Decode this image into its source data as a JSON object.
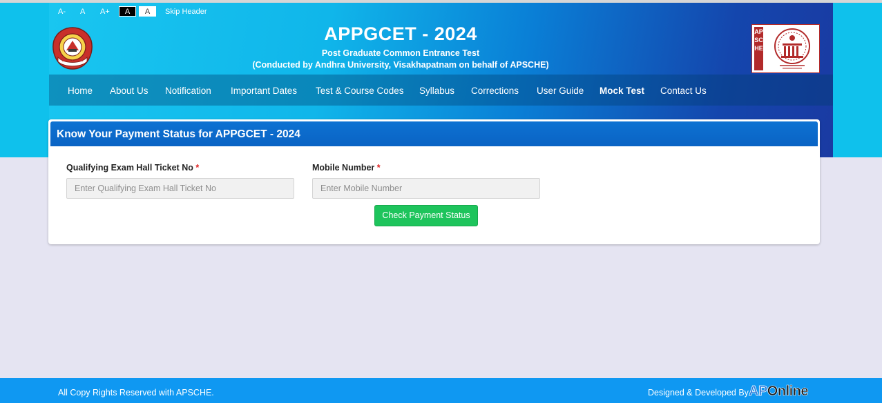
{
  "accessibility": {
    "decrease": "A-",
    "normal": "A",
    "increase": "A+",
    "dark_contrast": "A",
    "light_contrast": "A",
    "skip_header": "Skip Header"
  },
  "header": {
    "title": "APPGCET - 2024",
    "subtitle": "Post Graduate Common Entrance Test",
    "conducted_by": "(Conducted by Andhra University, Visakhapatnam on behalf of APSCHE)",
    "right_logo_text": "APSCHE"
  },
  "nav": {
    "items": [
      {
        "label": "Home"
      },
      {
        "label": "About Us"
      },
      {
        "label": "Notification"
      },
      {
        "label": "Important Dates"
      },
      {
        "label": "Test & Course Codes"
      },
      {
        "label": "Syllabus"
      },
      {
        "label": "Corrections"
      },
      {
        "label": "User Guide"
      },
      {
        "label": "Mock Test",
        "active": true
      },
      {
        "label": "Contact Us"
      }
    ]
  },
  "form": {
    "heading": "Know Your Payment Status for APPGCET - 2024",
    "hall_ticket_label": "Qualifying Exam Hall Ticket No",
    "hall_ticket_placeholder": "Enter Qualifying Exam Hall Ticket No",
    "hall_ticket_value": "",
    "mobile_label": "Mobile Number",
    "mobile_placeholder": "Enter Mobile Number",
    "mobile_value": "",
    "required_mark": "*",
    "submit_label": "Check Payment Status"
  },
  "footer": {
    "copyright": "All Copy Rights Reserved with APSCHE.",
    "designed_by": "Designed & Developed By",
    "brand_ap": "AP",
    "brand_online": "Online"
  },
  "colors": {
    "header_cyan": "#0fc1ec",
    "header_blue": "#1446ad",
    "card_header": "#0a63c4",
    "button_green": "#1ec45c",
    "footer_blue": "#0f98f2",
    "page_bg": "#e5e4f2",
    "required_red": "#e02424"
  }
}
